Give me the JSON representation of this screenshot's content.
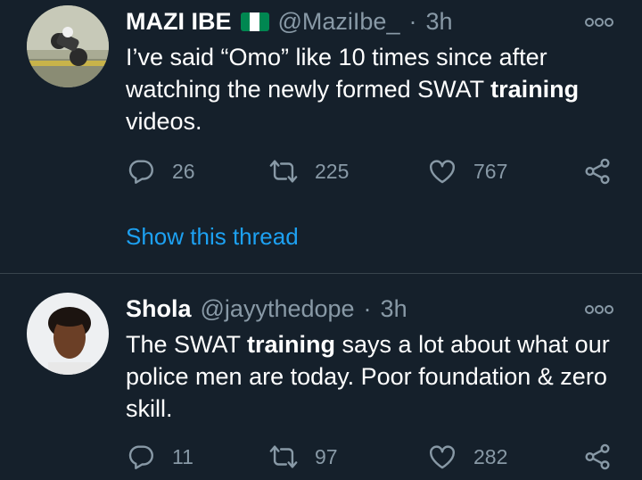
{
  "tweets": [
    {
      "name": "MAZI IBE",
      "handle": "@MaziIbe_",
      "separator": "·",
      "time": "3h",
      "text_before": "I’ve said “Omo” like 10 times since after watching the newly formed SWAT ",
      "text_bold": "training",
      "text_after": " videos.",
      "replies": "26",
      "retweets": "225",
      "likes": "767",
      "show_thread": "Show this thread",
      "avatar": "avatar-photo-motorcycle",
      "flag": "nigeria-flag"
    },
    {
      "name": "Shola",
      "handle": "@jayythedope",
      "separator": "·",
      "time": "3h",
      "text_before": "The SWAT ",
      "text_bold": "training",
      "text_after": " says a lot about what our police men are today. Poor foundation & zero skill.",
      "replies": "11",
      "retweets": "97",
      "likes": "282",
      "avatar": "avatar-photo-person"
    }
  ],
  "icons": {
    "reply": "reply-icon",
    "retweet": "retweet-icon",
    "like": "heart-icon",
    "share": "share-icon",
    "more": "more-icon"
  },
  "colors": {
    "background": "#15202b",
    "text": "#ffffff",
    "secondary": "#8899a6",
    "link": "#1da1f2",
    "divider": "#38444d",
    "flag_green": "#008751"
  }
}
